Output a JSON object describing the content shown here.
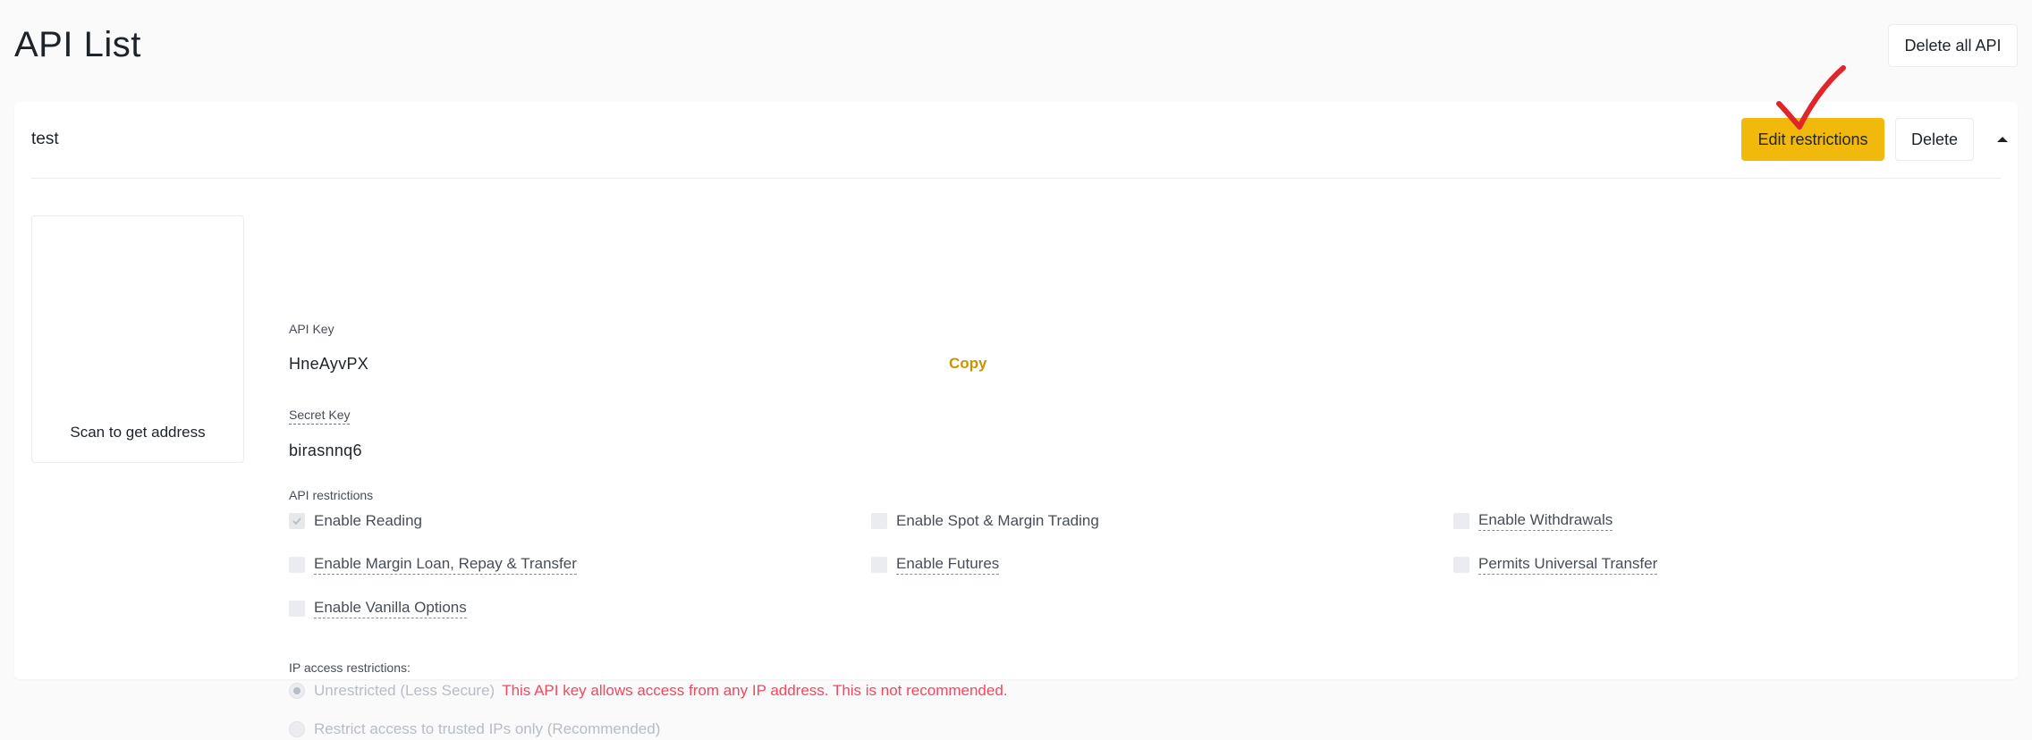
{
  "header": {
    "title": "API List",
    "delete_all_label": "Delete all API"
  },
  "api": {
    "name": "test",
    "edit_label": "Edit restrictions",
    "delete_label": "Delete",
    "qr_caption": "Scan to get address",
    "api_key_label": "API Key",
    "api_key_value": "HneAyvPX",
    "copy_label": "Copy",
    "secret_key_label": "Secret Key",
    "secret_key_value": "birasnnq6",
    "restrictions_label": "API restrictions",
    "restrictions": [
      {
        "label": "Enable Reading",
        "checked": true
      },
      {
        "label": "Enable Spot & Margin Trading",
        "checked": false
      },
      {
        "label": "Enable Withdrawals",
        "checked": false
      },
      {
        "label": "Enable Margin Loan, Repay & Transfer",
        "checked": false
      },
      {
        "label": "Enable Futures",
        "checked": false
      },
      {
        "label": "Permits Universal Transfer",
        "checked": false
      },
      {
        "label": "Enable Vanilla Options",
        "checked": false
      }
    ],
    "ip_label": "IP access restrictions:",
    "ip_options": [
      {
        "label": "Unrestricted (Less Secure)",
        "selected": true
      },
      {
        "label": "Restrict access to trusted IPs only (Recommended)",
        "selected": false
      }
    ],
    "ip_warning": "This API key allows access from any IP address. This is not recommended."
  },
  "colors": {
    "accent": "#f0b90b",
    "copy": "#c99400",
    "warning": "#f6465d",
    "annotation": "#e0252b"
  },
  "icons": {
    "collapse": "caret-up-icon",
    "check": "check-icon",
    "annotation": "red-checkmark-annotation"
  }
}
